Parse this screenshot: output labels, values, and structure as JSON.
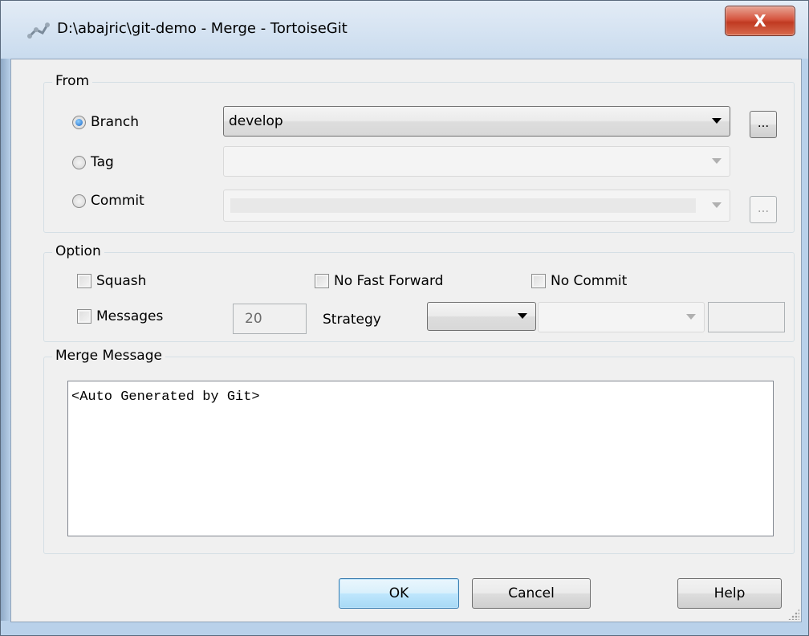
{
  "window": {
    "title": "D:\\abajric\\git-demo - Merge - TortoiseGit",
    "close_glyph": "X",
    "app_icon": "tortoisegit-merge-icon"
  },
  "from": {
    "label": "From",
    "branch_label": "Branch",
    "branch_value": "develop",
    "tag_label": "Tag",
    "tag_value": "",
    "commit_label": "Commit",
    "commit_value": "",
    "browse_glyph": "...",
    "selected": "Branch"
  },
  "option": {
    "label": "Option",
    "squash_label": "Squash",
    "no_fast_forward_label": "No Fast Forward",
    "no_commit_label": "No Commit",
    "messages_label": "Messages",
    "messages_count": "20",
    "strategy_label": "Strategy",
    "strategy_value": "",
    "strategy_option_value": "",
    "strategy_param_value": ""
  },
  "merge_message": {
    "label": "Merge Message",
    "text": "<Auto Generated by Git>"
  },
  "buttons": {
    "ok": "OK",
    "cancel": "Cancel",
    "help": "Help"
  },
  "colors": {
    "accent": "#3c7fb1",
    "close_button": "#c03a22",
    "titlebar": "#c9dbee"
  }
}
